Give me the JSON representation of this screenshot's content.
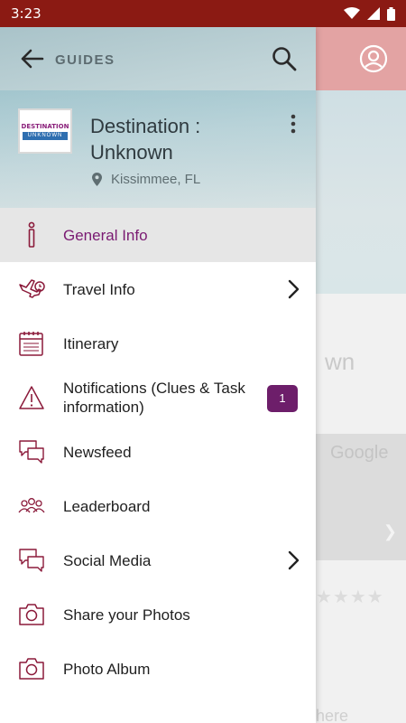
{
  "status_bar": {
    "time": "3:23"
  },
  "background": {
    "title_fragment": "wn",
    "map_brand": "Google",
    "bottom_fragment": "here",
    "rating_stars": "★★★★"
  },
  "drawer": {
    "header": {
      "section_title": "GUIDES",
      "guide_name": "Destination : Unknown",
      "location": "Kissimmee, FL",
      "logo_line1": "DESTINATION",
      "logo_line2": "UNKNOWN"
    },
    "menu": [
      {
        "label": "General Info",
        "icon": "info-icon",
        "active": true
      },
      {
        "label": "Travel Info",
        "icon": "plane-clock-icon",
        "chevron": true
      },
      {
        "label": "Itinerary",
        "icon": "calendar-icon"
      },
      {
        "label": "Notifications (Clues & Task information)",
        "icon": "warning-icon",
        "badge": "1"
      },
      {
        "label": "Newsfeed",
        "icon": "chat-bubbles-icon"
      },
      {
        "label": "Leaderboard",
        "icon": "people-icon"
      },
      {
        "label": "Social Media",
        "icon": "chat-bubbles-icon",
        "chevron": true
      },
      {
        "label": "Share your Photos",
        "icon": "camera-icon"
      },
      {
        "label": "Photo Album",
        "icon": "camera-icon"
      }
    ]
  },
  "colors": {
    "status_bar": "#8b1a13",
    "accent": "#7a1a72",
    "badge": "#6d1e6a",
    "icon": "#8b1a3a"
  }
}
